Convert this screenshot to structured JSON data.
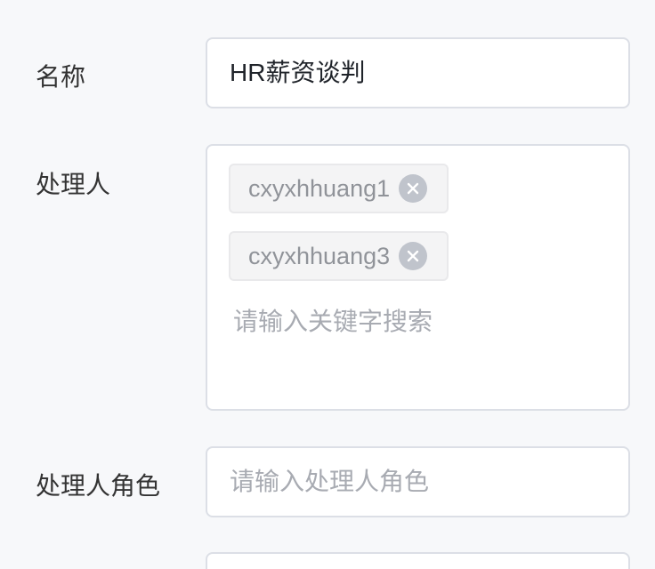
{
  "form": {
    "name": {
      "label": "名称",
      "value": "HR薪资谈判"
    },
    "handlers": {
      "label": "处理人",
      "tags": [
        {
          "label": "cxyxhhuang1",
          "remove_icon": "close-circle-icon"
        },
        {
          "label": "cxyxhhuang3",
          "remove_icon": "close-circle-icon"
        }
      ],
      "search_placeholder": "请输入关键字搜索"
    },
    "handler_role": {
      "label": "处理人角色",
      "placeholder": "请输入处理人角色"
    }
  }
}
